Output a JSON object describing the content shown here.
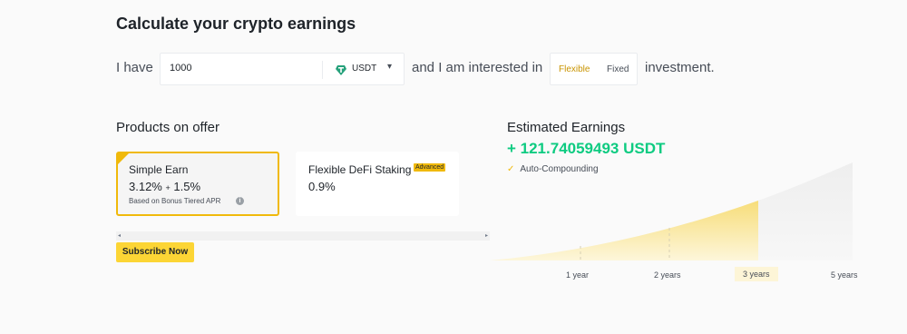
{
  "title": "Calculate your crypto earnings",
  "calc": {
    "prefix": "I have",
    "amount": "1000",
    "currency": "USDT",
    "caret": "▾",
    "middle": "and I am interested in",
    "options": [
      "Flexible",
      "Fixed"
    ],
    "selected": "Flexible",
    "suffix": "investment."
  },
  "products": {
    "heading": "Products on offer",
    "items": [
      {
        "name": "Simple Earn",
        "rate": "3.12%",
        "plus": "+",
        "bonus": "1.5%",
        "sub": "Based on Bonus Tiered APR",
        "selected": true
      },
      {
        "name": "Flexible DeFi Staking",
        "badge": "Advanced",
        "rate": "0.9%",
        "selected": false
      }
    ],
    "scroll_left": "◂",
    "scroll_right": "▸",
    "subscribe": "Subscribe Now"
  },
  "earnings": {
    "heading": "Estimated Earnings",
    "value": "+ 121.74059493 USDT",
    "auto_compound": "Auto-Compounding",
    "check_icon": "✓",
    "ticks": [
      "1 year",
      "2 years",
      "3 years",
      "5 years"
    ],
    "selected_tick": "3 years",
    "colors": {
      "highlight": "#f0b90b",
      "positive": "#0ecb81"
    }
  }
}
